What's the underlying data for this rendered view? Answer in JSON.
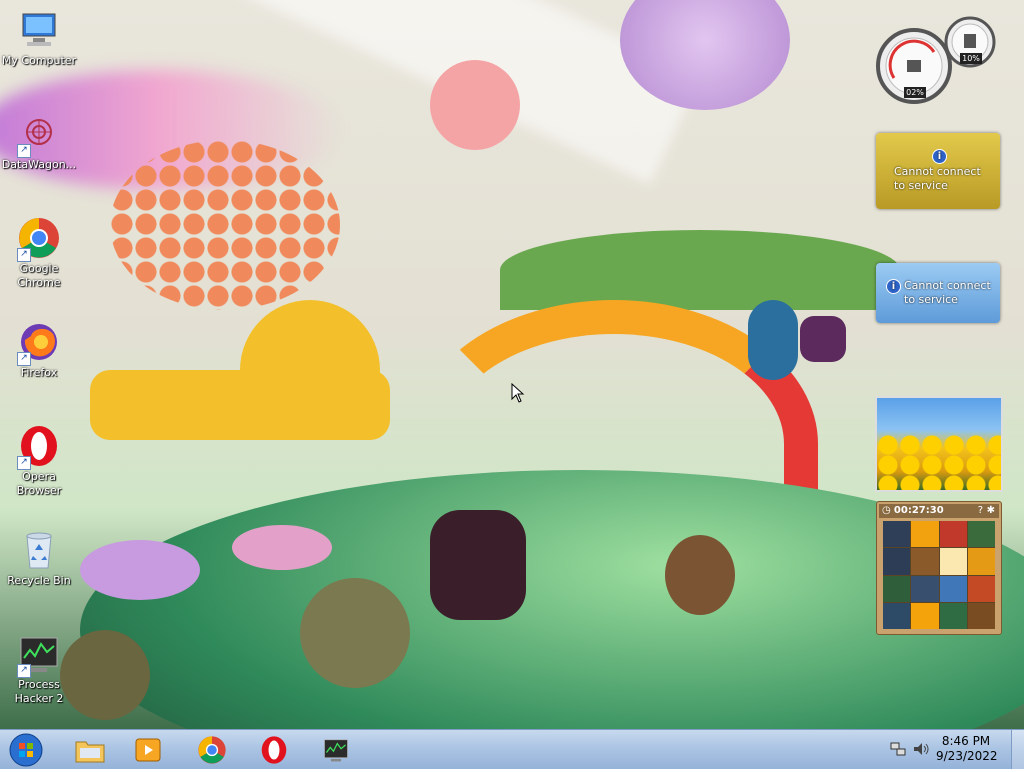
{
  "desktop_icons": [
    {
      "label": "My Computer"
    },
    {
      "label": "DataWagon..."
    },
    {
      "label": "Google Chrome"
    },
    {
      "label": "Firefox"
    },
    {
      "label": "Opera Browser"
    },
    {
      "label": "Recycle Bin"
    },
    {
      "label": "Process Hacker 2"
    }
  ],
  "gadgets": {
    "cpu_meter": {
      "cpu_percent": "02%",
      "memory_percent": "10%"
    },
    "weather_1": {
      "message": "Cannot connect to service"
    },
    "weather_2": {
      "message": "Cannot connect to service"
    },
    "puzzle": {
      "timer": "00:27:30"
    }
  },
  "taskbar": {
    "start_button": "start-orb",
    "pinned": [
      "explorer-icon",
      "media-player-icon",
      "chrome-icon",
      "opera-icon",
      "process-hacker-icon"
    ]
  },
  "tray": {
    "time": "8:46 PM",
    "date": "9/23/2022"
  },
  "colors": {
    "taskbar": "#a9c3e3",
    "weather_yellow": "#d1b83a",
    "weather_blue": "#7db3e6"
  }
}
